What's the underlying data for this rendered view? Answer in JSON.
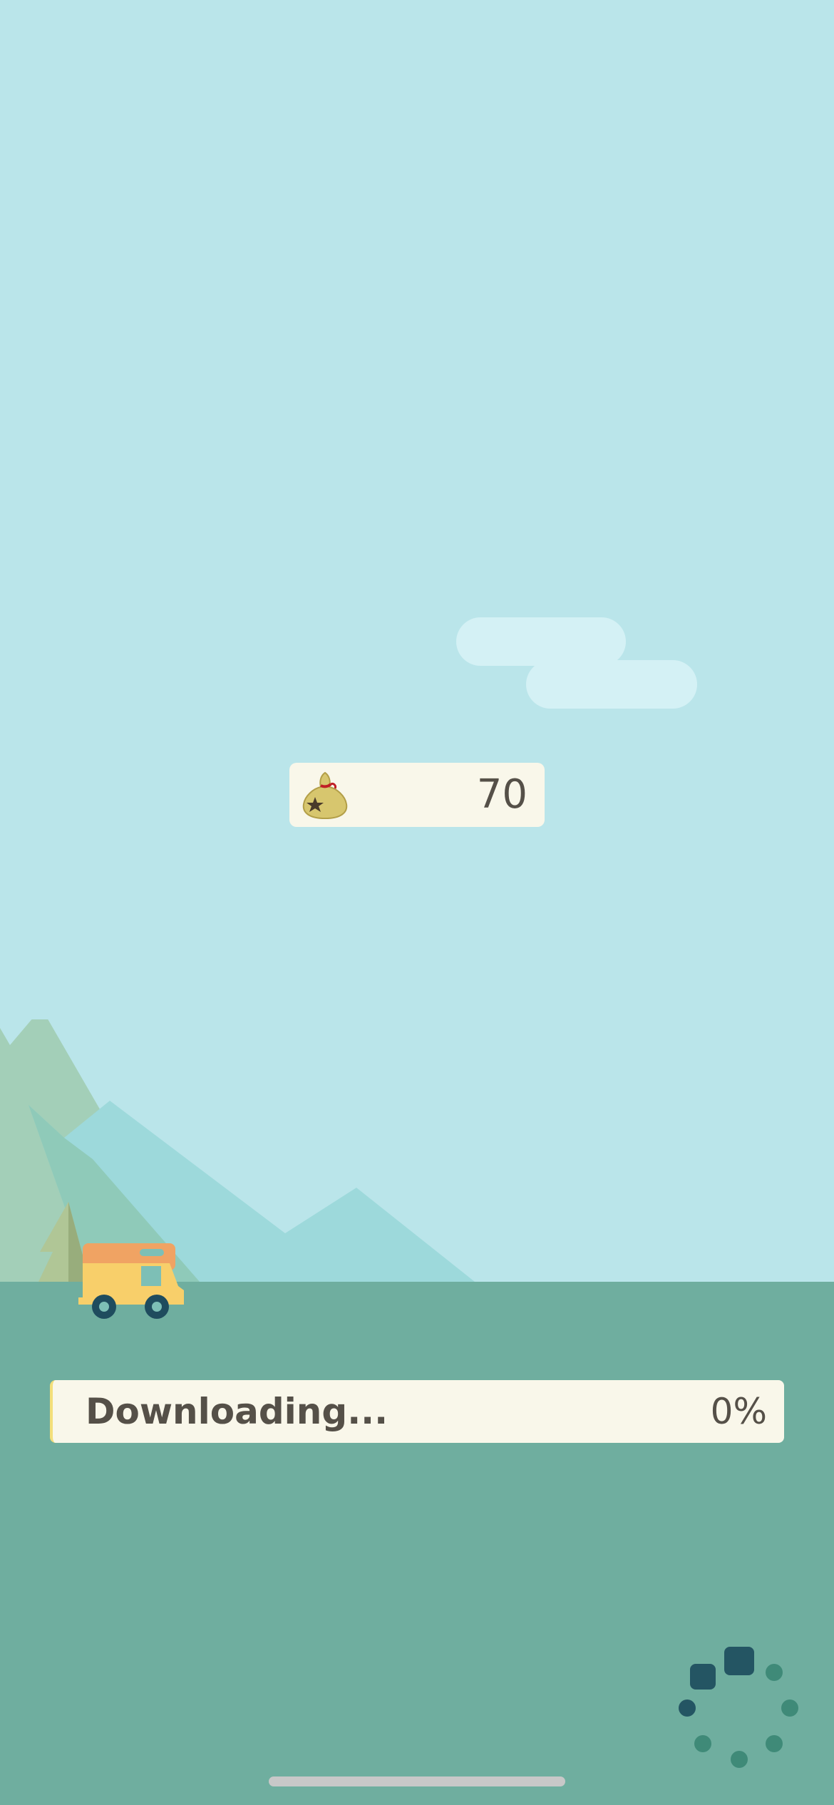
{
  "header": {
    "bells": {
      "icon": "bell-bag-icon",
      "count": "70"
    }
  },
  "scene": {
    "icons": [
      "mountain-icon",
      "tree-icon",
      "camper-van-icon",
      "cloud-icon"
    ]
  },
  "download": {
    "label": "Downloading...",
    "percent_text": "0%",
    "progress": 0
  },
  "spinner": {
    "icon": "loading-spinner-icon"
  },
  "colors": {
    "sky": "#bae5ea",
    "ground": "#6fae9f",
    "panel": "#f9f7ea",
    "text": "#555048",
    "progress_fill": "#f3df7a"
  }
}
